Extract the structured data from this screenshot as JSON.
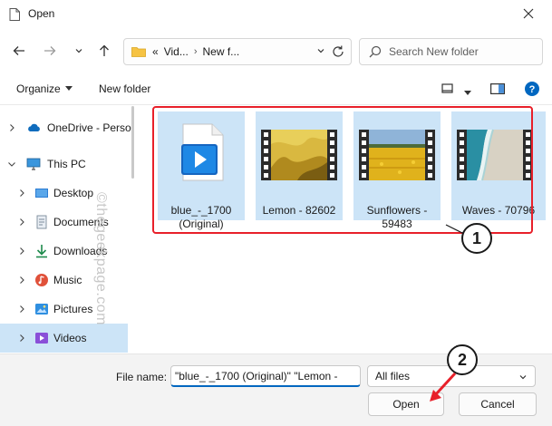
{
  "window": {
    "title": "Open"
  },
  "address": {
    "crumbs": [
      "Vid...",
      "New f..."
    ],
    "overflow": "«"
  },
  "search": {
    "placeholder": "Search New folder"
  },
  "toolbar": {
    "organize": "Organize",
    "new_folder": "New folder"
  },
  "sidebar": {
    "items": [
      {
        "label": "OneDrive - Perso",
        "icon": "cloud-icon"
      },
      {
        "label": "This PC",
        "icon": "monitor-icon"
      },
      {
        "label": "Desktop",
        "icon": "desktop-icon"
      },
      {
        "label": "Documents",
        "icon": "document-icon"
      },
      {
        "label": "Downloads",
        "icon": "download-icon"
      },
      {
        "label": "Music",
        "icon": "music-icon"
      },
      {
        "label": "Pictures",
        "icon": "pictures-icon"
      },
      {
        "label": "Videos",
        "icon": "videos-icon"
      }
    ]
  },
  "files": [
    {
      "name_line1": "blue_-_1700",
      "name_line2": "(Original)",
      "kind": "video-file-icon"
    },
    {
      "name_line1": "Lemon - 82602",
      "name_line2": "",
      "kind": "video-thumbnail"
    },
    {
      "name_line1": "Sunflowers -",
      "name_line2": "59483",
      "kind": "video-thumbnail"
    },
    {
      "name_line1": "Waves - 70796",
      "name_line2": "",
      "kind": "video-thumbnail"
    }
  ],
  "annotations": {
    "step1": "1",
    "step2": "2",
    "watermark": "©thegeekpage.com"
  },
  "footer": {
    "file_name_label": "File name:",
    "file_name_value": "\"blue_-_1700 (Original)\" \"Lemon -",
    "file_type": "All files",
    "open_label": "Open",
    "cancel_label": "Cancel"
  },
  "colors": {
    "selection": "#cce4f7",
    "accent": "#0067c0",
    "highlight": "#e8202a"
  }
}
